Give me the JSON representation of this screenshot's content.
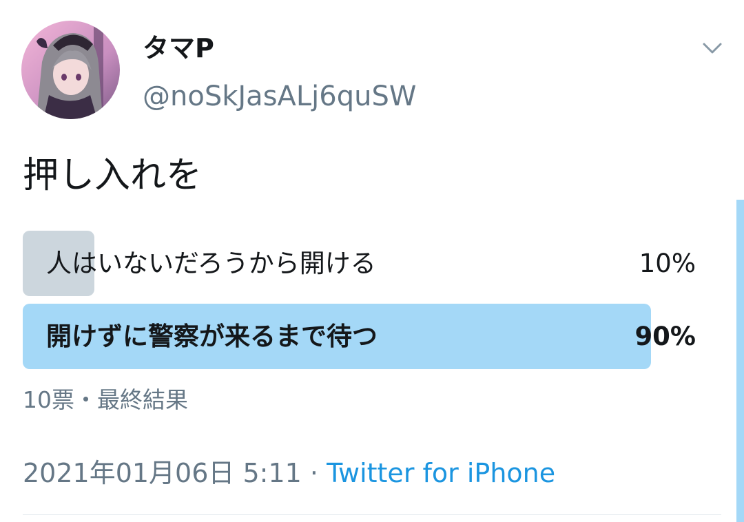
{
  "user": {
    "display_name": "タマP",
    "handle": "@noSkJasALj6quSW"
  },
  "tweet": {
    "text": "押し入れを"
  },
  "poll": {
    "options": [
      {
        "label": "人はいないだろうから開ける",
        "percent": "10%",
        "fraction": 0.1,
        "winner": false
      },
      {
        "label": "開けずに警察が来るまで待つ",
        "percent": "90%",
        "fraction": 0.9,
        "winner": true
      }
    ],
    "summary": "10票・最終結果"
  },
  "meta": {
    "date_time": "2021年01月06日 5:11",
    "separator": " · ",
    "source": "Twitter for iPhone"
  },
  "colors": {
    "loser_bar": "#ccd6dd",
    "winner_bar": "#a4d8f7",
    "link": "#1b95e0",
    "secondary_text": "#657786"
  },
  "icons": {
    "menu": "chevron-down-icon",
    "avatar": "avatar"
  }
}
